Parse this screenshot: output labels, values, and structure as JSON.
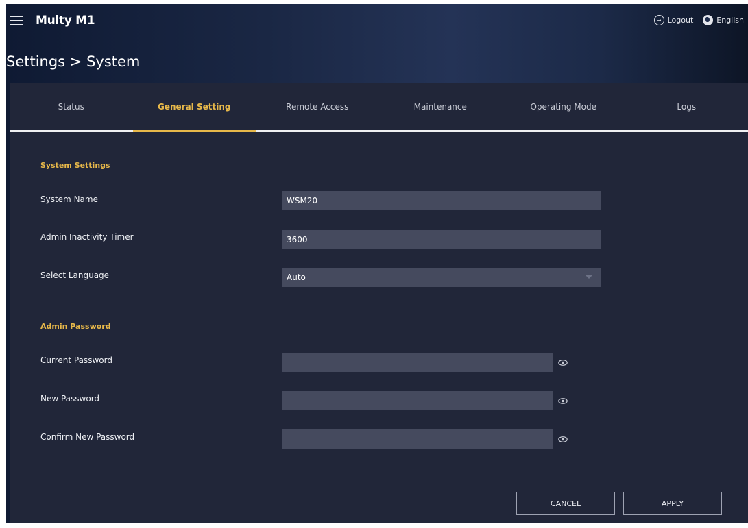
{
  "header": {
    "brand": "Multy M1",
    "logout_label": "Logout",
    "language_label": "English"
  },
  "page": {
    "title": "Settings > System"
  },
  "tabs": [
    {
      "label": "Status",
      "active": false
    },
    {
      "label": "General Setting",
      "active": true
    },
    {
      "label": "Remote Access",
      "active": false
    },
    {
      "label": "Maintenance",
      "active": false
    },
    {
      "label": "Operating Mode",
      "active": false
    },
    {
      "label": "Logs",
      "active": false
    }
  ],
  "system_settings": {
    "heading": "System Settings",
    "system_name": {
      "label": "System Name",
      "value": "WSM20"
    },
    "admin_inactivity_timer": {
      "label": "Admin Inactivity Timer",
      "value": "3600"
    },
    "select_language": {
      "label": "Select Language",
      "value": "Auto"
    }
  },
  "admin_password": {
    "heading": "Admin Password",
    "current_password": {
      "label": "Current Password",
      "value": ""
    },
    "new_password": {
      "label": "New Password",
      "value": ""
    },
    "confirm_new_password": {
      "label": "Confirm New Password",
      "value": ""
    }
  },
  "actions": {
    "cancel_label": "CANCEL",
    "apply_label": "APPLY"
  },
  "colors": {
    "accent": "#e7b84a",
    "panel_bg": "#212639",
    "field_bg": "#454a5e"
  }
}
